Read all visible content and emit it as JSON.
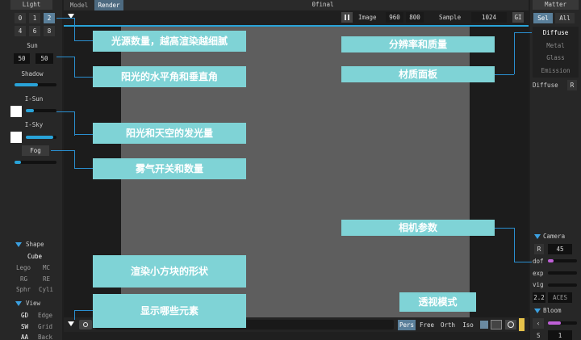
{
  "light_panel": {
    "header": "Light",
    "counts": [
      "0",
      "1",
      "2",
      "4",
      "6",
      "8"
    ],
    "sun_label": "Sun",
    "sun_values": [
      "50",
      "50"
    ],
    "shadow_label": "Shadow",
    "shadow_level": 0.55,
    "isun_label": "I-Sun",
    "isun_level": 0.25,
    "isky_label": "I-Sky",
    "isky_level": 0.9,
    "fog_label": "Fog",
    "fog_level": 0.15
  },
  "shape_panel": {
    "header": "Shape",
    "items": [
      "Cube",
      "Lego",
      "MC",
      "RG",
      "RE",
      "Sphr",
      "Cyli"
    ]
  },
  "view_panel": {
    "header": "View",
    "items": [
      "GD",
      "Edge",
      "SW",
      "Grid",
      "AA",
      "Back"
    ]
  },
  "top_bar": {
    "tabs": [
      "Model",
      "Render"
    ],
    "title": "0final",
    "image_label": "Image",
    "image_w": "960",
    "image_h": "800",
    "sample_label": "Sample",
    "sample_value": "1024",
    "gi_label": "GI"
  },
  "bottom_bar": {
    "modes": [
      "Pers",
      "Free",
      "Orth",
      "Iso"
    ]
  },
  "matter_panel": {
    "header": "Matter",
    "tabs": [
      "Sel",
      "All"
    ],
    "materials": [
      "Diffuse",
      "Metal",
      "Glass",
      "Emission"
    ],
    "current_label": "Diffuse",
    "current_key": "R"
  },
  "camera_panel": {
    "header": "Camera",
    "fov_label": "R",
    "fov_value": "45",
    "dof_label": "dof",
    "dof_level": 0.2,
    "exp_label": "exp",
    "vig_label": "vig",
    "value": "2.2",
    "aces_label": "ACES",
    "bloom_header": "Bloom",
    "bloom_level": 0.45,
    "s_label": "S",
    "s_value": "1"
  },
  "annotations": {
    "a1": "光源数量，越高渲染越细腻",
    "a2": "阳光的水平角和垂直角",
    "a3": "阳光和天空的发光量",
    "a4": "雾气开关和数量",
    "a5": "渲染小方块的形状",
    "a6": "显示哪些元素",
    "a7": "分辨率和质量",
    "a8": "材质面板",
    "a9": "相机参数",
    "a10": "透视模式"
  },
  "colors": {
    "accent": "#29a3d8",
    "callout": "#7fd3d6",
    "canvas": "#5e5e5e",
    "bloom": "#c060d8"
  }
}
